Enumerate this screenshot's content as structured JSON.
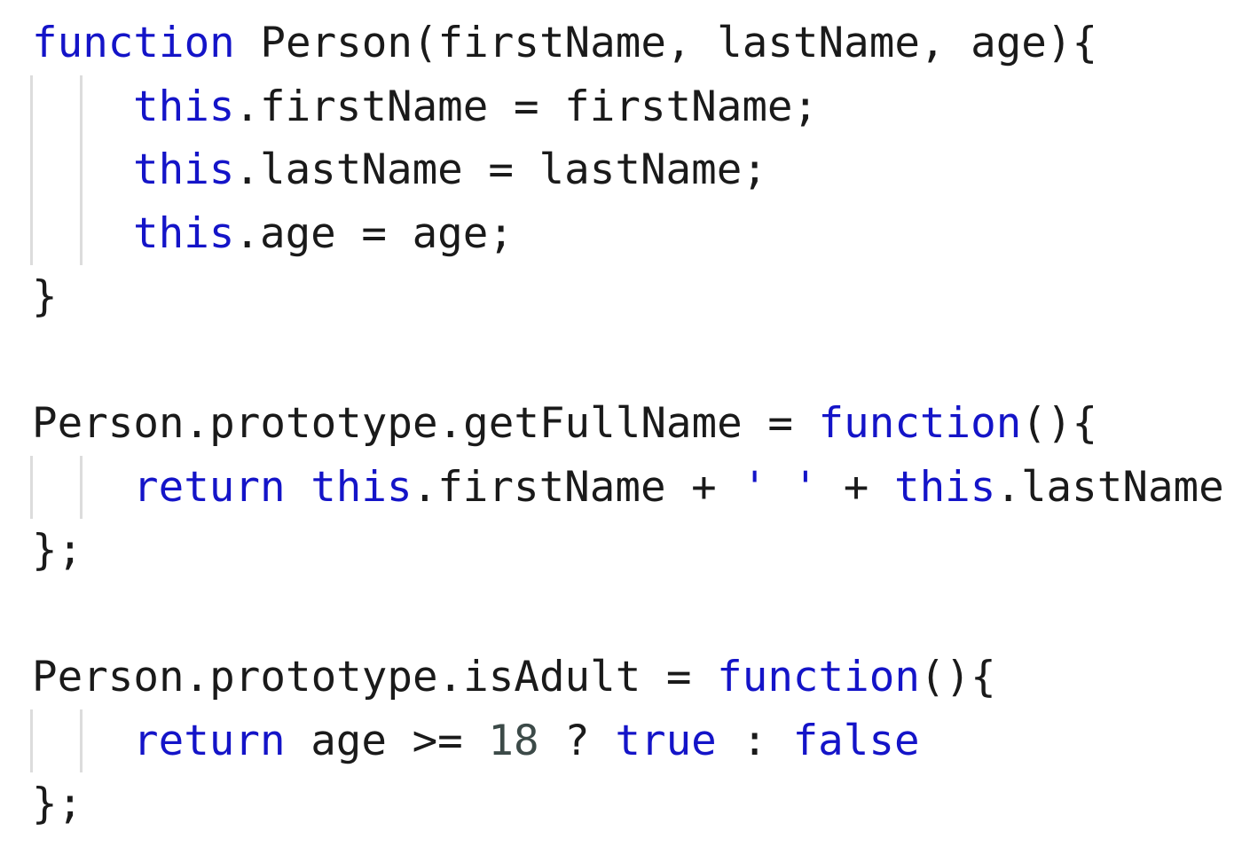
{
  "editor": {
    "language": "javascript",
    "colors": {
      "background": "#ffffff",
      "keyword": "#1414c8",
      "plain": "#1a1a1a",
      "number": "#3c4a48",
      "string": "#1414c8",
      "indent_guide": "#dcdcdc"
    },
    "lines": [
      {
        "indent": 0,
        "tokens": [
          {
            "type": "keyword",
            "text": "function"
          },
          {
            "type": "plain",
            "text": " Person(firstName, lastName, age){"
          }
        ]
      },
      {
        "indent": 1,
        "tokens": [
          {
            "type": "keyword",
            "text": "this"
          },
          {
            "type": "plain",
            "text": ".firstName = firstName;"
          }
        ]
      },
      {
        "indent": 1,
        "tokens": [
          {
            "type": "keyword",
            "text": "this"
          },
          {
            "type": "plain",
            "text": ".lastName = lastName;"
          }
        ]
      },
      {
        "indent": 1,
        "tokens": [
          {
            "type": "keyword",
            "text": "this"
          },
          {
            "type": "plain",
            "text": ".age = age;"
          }
        ]
      },
      {
        "indent": 0,
        "tokens": [
          {
            "type": "plain",
            "text": "}"
          }
        ]
      },
      {
        "indent": 0,
        "tokens": []
      },
      {
        "indent": 0,
        "tokens": [
          {
            "type": "plain",
            "text": "Person.prototype.getFullName = "
          },
          {
            "type": "keyword",
            "text": "function"
          },
          {
            "type": "plain",
            "text": "(){"
          }
        ]
      },
      {
        "indent": 1,
        "tokens": [
          {
            "type": "keyword",
            "text": "return"
          },
          {
            "type": "plain",
            "text": " "
          },
          {
            "type": "keyword",
            "text": "this"
          },
          {
            "type": "plain",
            "text": ".firstName + "
          },
          {
            "type": "string",
            "text": "' '"
          },
          {
            "type": "plain",
            "text": " + "
          },
          {
            "type": "keyword",
            "text": "this"
          },
          {
            "type": "plain",
            "text": ".lastName"
          }
        ]
      },
      {
        "indent": 0,
        "tokens": [
          {
            "type": "plain",
            "text": "};"
          }
        ]
      },
      {
        "indent": 0,
        "tokens": []
      },
      {
        "indent": 0,
        "tokens": [
          {
            "type": "plain",
            "text": "Person.prototype.isAdult = "
          },
          {
            "type": "keyword",
            "text": "function"
          },
          {
            "type": "plain",
            "text": "(){"
          }
        ]
      },
      {
        "indent": 1,
        "tokens": [
          {
            "type": "keyword",
            "text": "return"
          },
          {
            "type": "plain",
            "text": " age >= "
          },
          {
            "type": "number",
            "text": "18"
          },
          {
            "type": "plain",
            "text": " ? "
          },
          {
            "type": "keyword",
            "text": "true"
          },
          {
            "type": "plain",
            "text": " : "
          },
          {
            "type": "keyword",
            "text": "false"
          }
        ]
      },
      {
        "indent": 0,
        "tokens": [
          {
            "type": "plain",
            "text": "};"
          }
        ]
      }
    ]
  }
}
